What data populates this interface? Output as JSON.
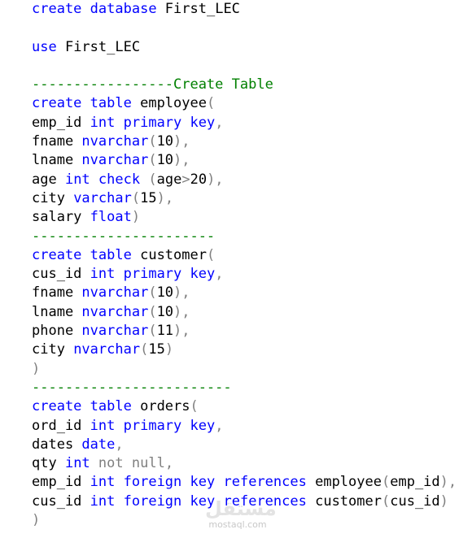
{
  "code_lines": [
    [
      {
        "t": "create",
        "c": "kw"
      },
      {
        "t": " ",
        "c": "id"
      },
      {
        "t": "database",
        "c": "kw"
      },
      {
        "t": " First_LEC",
        "c": "id"
      }
    ],
    [],
    [
      {
        "t": "use",
        "c": "kw"
      },
      {
        "t": " First_LEC",
        "c": "id"
      }
    ],
    [],
    [
      {
        "t": "-----------------Create Table",
        "c": "comment"
      }
    ],
    [
      {
        "t": "create",
        "c": "kw"
      },
      {
        "t": " ",
        "c": "id"
      },
      {
        "t": "table",
        "c": "kw"
      },
      {
        "t": " employee",
        "c": "id"
      },
      {
        "t": "(",
        "c": "punct"
      }
    ],
    [
      {
        "t": "emp_id ",
        "c": "id"
      },
      {
        "t": "int",
        "c": "kw"
      },
      {
        "t": " ",
        "c": "id"
      },
      {
        "t": "primary",
        "c": "kw"
      },
      {
        "t": " ",
        "c": "id"
      },
      {
        "t": "key",
        "c": "kw"
      },
      {
        "t": ",",
        "c": "punct"
      }
    ],
    [
      {
        "t": "fname ",
        "c": "id"
      },
      {
        "t": "nvarchar",
        "c": "kw"
      },
      {
        "t": "(",
        "c": "punct"
      },
      {
        "t": "10",
        "c": "id"
      },
      {
        "t": "),",
        "c": "punct"
      }
    ],
    [
      {
        "t": "lname ",
        "c": "id"
      },
      {
        "t": "nvarchar",
        "c": "kw"
      },
      {
        "t": "(",
        "c": "punct"
      },
      {
        "t": "10",
        "c": "id"
      },
      {
        "t": "),",
        "c": "punct"
      }
    ],
    [
      {
        "t": "age ",
        "c": "id"
      },
      {
        "t": "int",
        "c": "kw"
      },
      {
        "t": " ",
        "c": "id"
      },
      {
        "t": "check",
        "c": "kw"
      },
      {
        "t": " ",
        "c": "id"
      },
      {
        "t": "(",
        "c": "punct"
      },
      {
        "t": "age",
        "c": "id"
      },
      {
        "t": ">",
        "c": "punct"
      },
      {
        "t": "20",
        "c": "id"
      },
      {
        "t": "),",
        "c": "punct"
      }
    ],
    [
      {
        "t": "city ",
        "c": "id"
      },
      {
        "t": "varchar",
        "c": "kw"
      },
      {
        "t": "(",
        "c": "punct"
      },
      {
        "t": "15",
        "c": "id"
      },
      {
        "t": "),",
        "c": "punct"
      }
    ],
    [
      {
        "t": "salary ",
        "c": "id"
      },
      {
        "t": "float",
        "c": "kw"
      },
      {
        "t": ")",
        "c": "punct"
      }
    ],
    [
      {
        "t": "----------------------",
        "c": "comment"
      }
    ],
    [
      {
        "t": "create",
        "c": "kw"
      },
      {
        "t": " ",
        "c": "id"
      },
      {
        "t": "table",
        "c": "kw"
      },
      {
        "t": " customer",
        "c": "id"
      },
      {
        "t": "(",
        "c": "punct"
      }
    ],
    [
      {
        "t": "cus_id ",
        "c": "id"
      },
      {
        "t": "int",
        "c": "kw"
      },
      {
        "t": " ",
        "c": "id"
      },
      {
        "t": "primary",
        "c": "kw"
      },
      {
        "t": " ",
        "c": "id"
      },
      {
        "t": "key",
        "c": "kw"
      },
      {
        "t": ",",
        "c": "punct"
      }
    ],
    [
      {
        "t": "fname ",
        "c": "id"
      },
      {
        "t": "nvarchar",
        "c": "kw"
      },
      {
        "t": "(",
        "c": "punct"
      },
      {
        "t": "10",
        "c": "id"
      },
      {
        "t": "),",
        "c": "punct"
      }
    ],
    [
      {
        "t": "lname ",
        "c": "id"
      },
      {
        "t": "nvarchar",
        "c": "kw"
      },
      {
        "t": "(",
        "c": "punct"
      },
      {
        "t": "10",
        "c": "id"
      },
      {
        "t": "),",
        "c": "punct"
      }
    ],
    [
      {
        "t": "phone ",
        "c": "id"
      },
      {
        "t": "nvarchar",
        "c": "kw"
      },
      {
        "t": "(",
        "c": "punct"
      },
      {
        "t": "11",
        "c": "id"
      },
      {
        "t": "),",
        "c": "punct"
      }
    ],
    [
      {
        "t": "city ",
        "c": "id"
      },
      {
        "t": "nvarchar",
        "c": "kw"
      },
      {
        "t": "(",
        "c": "punct"
      },
      {
        "t": "15",
        "c": "id"
      },
      {
        "t": ")",
        "c": "punct"
      }
    ],
    [
      {
        "t": ")",
        "c": "punct"
      }
    ],
    [
      {
        "t": "------------------------",
        "c": "comment"
      }
    ],
    [
      {
        "t": "create",
        "c": "kw"
      },
      {
        "t": " ",
        "c": "id"
      },
      {
        "t": "table",
        "c": "kw"
      },
      {
        "t": " orders",
        "c": "id"
      },
      {
        "t": "(",
        "c": "punct"
      }
    ],
    [
      {
        "t": "ord_id ",
        "c": "id"
      },
      {
        "t": "int",
        "c": "kw"
      },
      {
        "t": " ",
        "c": "id"
      },
      {
        "t": "primary",
        "c": "kw"
      },
      {
        "t": " ",
        "c": "id"
      },
      {
        "t": "key",
        "c": "kw"
      },
      {
        "t": ",",
        "c": "punct"
      }
    ],
    [
      {
        "t": "dates ",
        "c": "id"
      },
      {
        "t": "date",
        "c": "kw"
      },
      {
        "t": ",",
        "c": "punct"
      }
    ],
    [
      {
        "t": "qty ",
        "c": "id"
      },
      {
        "t": "int",
        "c": "kw"
      },
      {
        "t": " ",
        "c": "id"
      },
      {
        "t": "not",
        "c": "gray"
      },
      {
        "t": " ",
        "c": "id"
      },
      {
        "t": "null",
        "c": "gray"
      },
      {
        "t": ",",
        "c": "punct"
      }
    ],
    [
      {
        "t": "emp_id ",
        "c": "id"
      },
      {
        "t": "int",
        "c": "kw"
      },
      {
        "t": " ",
        "c": "id"
      },
      {
        "t": "foreign",
        "c": "kw"
      },
      {
        "t": " ",
        "c": "id"
      },
      {
        "t": "key",
        "c": "kw"
      },
      {
        "t": " ",
        "c": "id"
      },
      {
        "t": "references",
        "c": "kw"
      },
      {
        "t": " employee",
        "c": "id"
      },
      {
        "t": "(",
        "c": "punct"
      },
      {
        "t": "emp_id",
        "c": "id"
      },
      {
        "t": "),",
        "c": "punct"
      }
    ],
    [
      {
        "t": "cus_id ",
        "c": "id"
      },
      {
        "t": "int",
        "c": "kw"
      },
      {
        "t": " ",
        "c": "id"
      },
      {
        "t": "foreign",
        "c": "kw"
      },
      {
        "t": " ",
        "c": "id"
      },
      {
        "t": "key",
        "c": "kw"
      },
      {
        "t": " ",
        "c": "id"
      },
      {
        "t": "references",
        "c": "kw"
      },
      {
        "t": " customer",
        "c": "id"
      },
      {
        "t": "(",
        "c": "punct"
      },
      {
        "t": "cus_id",
        "c": "id"
      },
      {
        "t": ")",
        "c": "punct"
      }
    ],
    [
      {
        "t": ")",
        "c": "punct"
      }
    ]
  ],
  "watermark": {
    "main": "مستقل",
    "sub": "mostaql.com"
  }
}
